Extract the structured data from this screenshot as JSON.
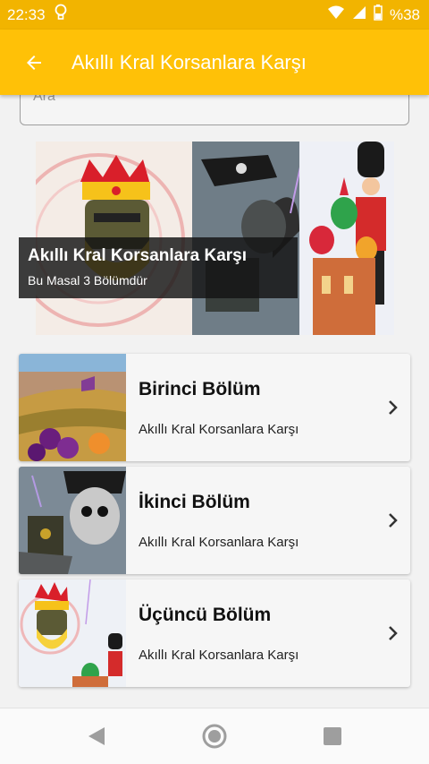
{
  "status_bar": {
    "time": "22:33",
    "battery": "%38"
  },
  "app_bar": {
    "title": "Akıllı Kral Korsanlara Karşı",
    "back_icon": "arrow-back-icon"
  },
  "search": {
    "placeholder": "Ara"
  },
  "hero": {
    "title": "Akıllı Kral Korsanlara Karşı",
    "subtitle": "Bu Masal 3 Bölümdür"
  },
  "episodes": [
    {
      "title": "Birinci Bölüm",
      "subtitle": "Akıllı Kral Korsanlara Karşı"
    },
    {
      "title": "İkinci Bölüm",
      "subtitle": "Akıllı Kral Korsanlara Karşı"
    },
    {
      "title": "Üçüncü Bölüm",
      "subtitle": "Akıllı Kral Korsanlara Karşı"
    }
  ],
  "colors": {
    "status_bar": "#f2b400",
    "app_bar": "#ffc107"
  }
}
